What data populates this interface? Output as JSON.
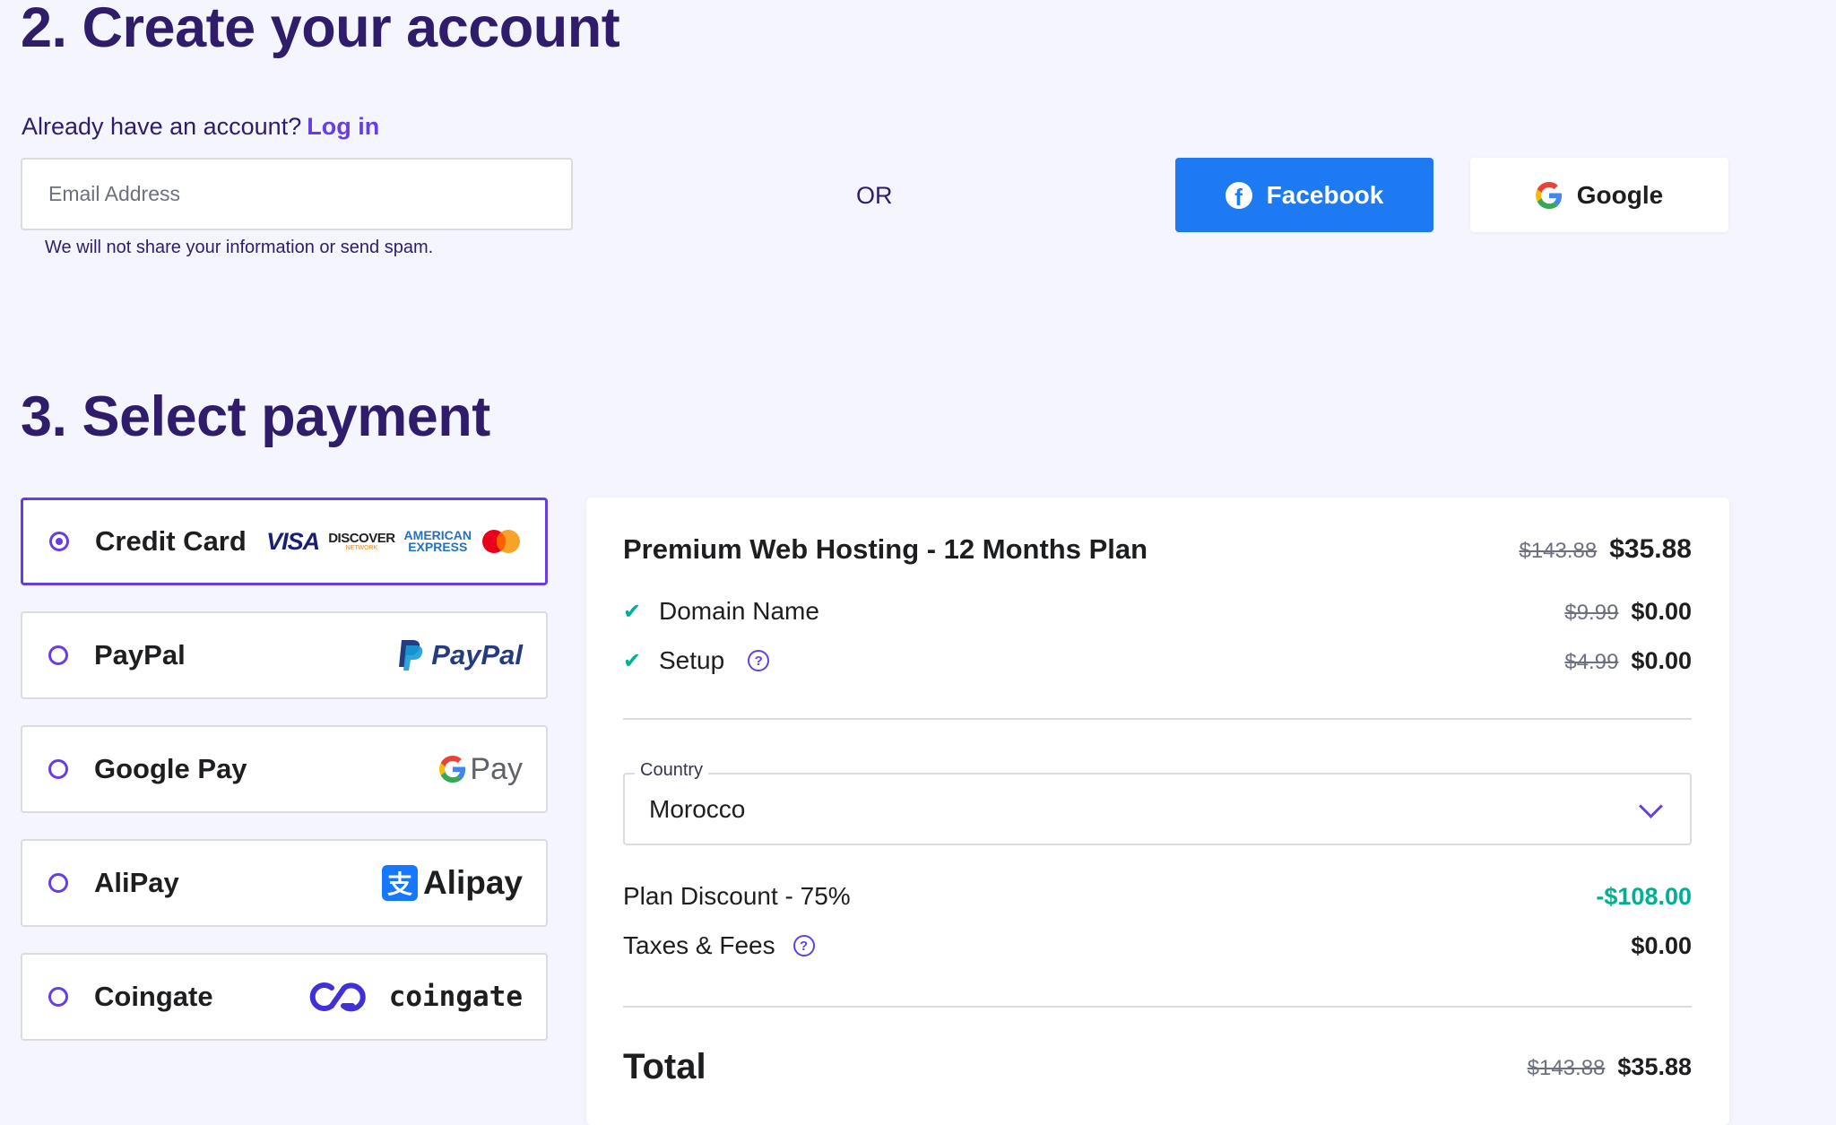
{
  "account": {
    "title": "2. Create your account",
    "already_text": "Already have an account?",
    "login_label": "Log in",
    "email_placeholder": "Email Address",
    "spam_note": "We will not share your information or send spam.",
    "or_text": "OR",
    "facebook_label": "Facebook",
    "google_label": "Google"
  },
  "payment": {
    "title": "3. Select payment",
    "methods": [
      {
        "label": "Credit Card",
        "selected": true
      },
      {
        "label": "PayPal",
        "selected": false
      },
      {
        "label": "Google Pay",
        "selected": false
      },
      {
        "label": "AliPay",
        "selected": false
      },
      {
        "label": "Coingate",
        "selected": false
      }
    ],
    "logos": {
      "visa": "VISA",
      "discover": "DISCOVER",
      "discover_sub": "NETWORK",
      "amex_line1": "AMERICAN",
      "amex_line2": "EXPRESS",
      "paypal": "PayPal",
      "gpay": "Pay",
      "alipay": "Alipay",
      "alipay_glyph": "支",
      "coingate": "coingate"
    }
  },
  "summary": {
    "plan_name": "Premium Web Hosting - 12 Months Plan",
    "plan_old_price": "$143.88",
    "plan_price": "$35.88",
    "items": [
      {
        "label": "Domain Name",
        "old_price": "$9.99",
        "price": "$0.00",
        "help": false
      },
      {
        "label": "Setup",
        "old_price": "$4.99",
        "price": "$0.00",
        "help": true
      }
    ],
    "country_label": "Country",
    "country_value": "Morocco",
    "discount_label": "Plan Discount - 75%",
    "discount_amount": "-$108.00",
    "taxes_label": "Taxes & Fees",
    "taxes_amount": "$0.00",
    "total_label": "Total",
    "total_old_price": "$143.88",
    "total_price": "$35.88"
  },
  "colors": {
    "accent": "#673de6",
    "heading": "#2f1c6a",
    "facebook": "#1d7af2",
    "success": "#00b090",
    "background": "#f4f5ff"
  }
}
